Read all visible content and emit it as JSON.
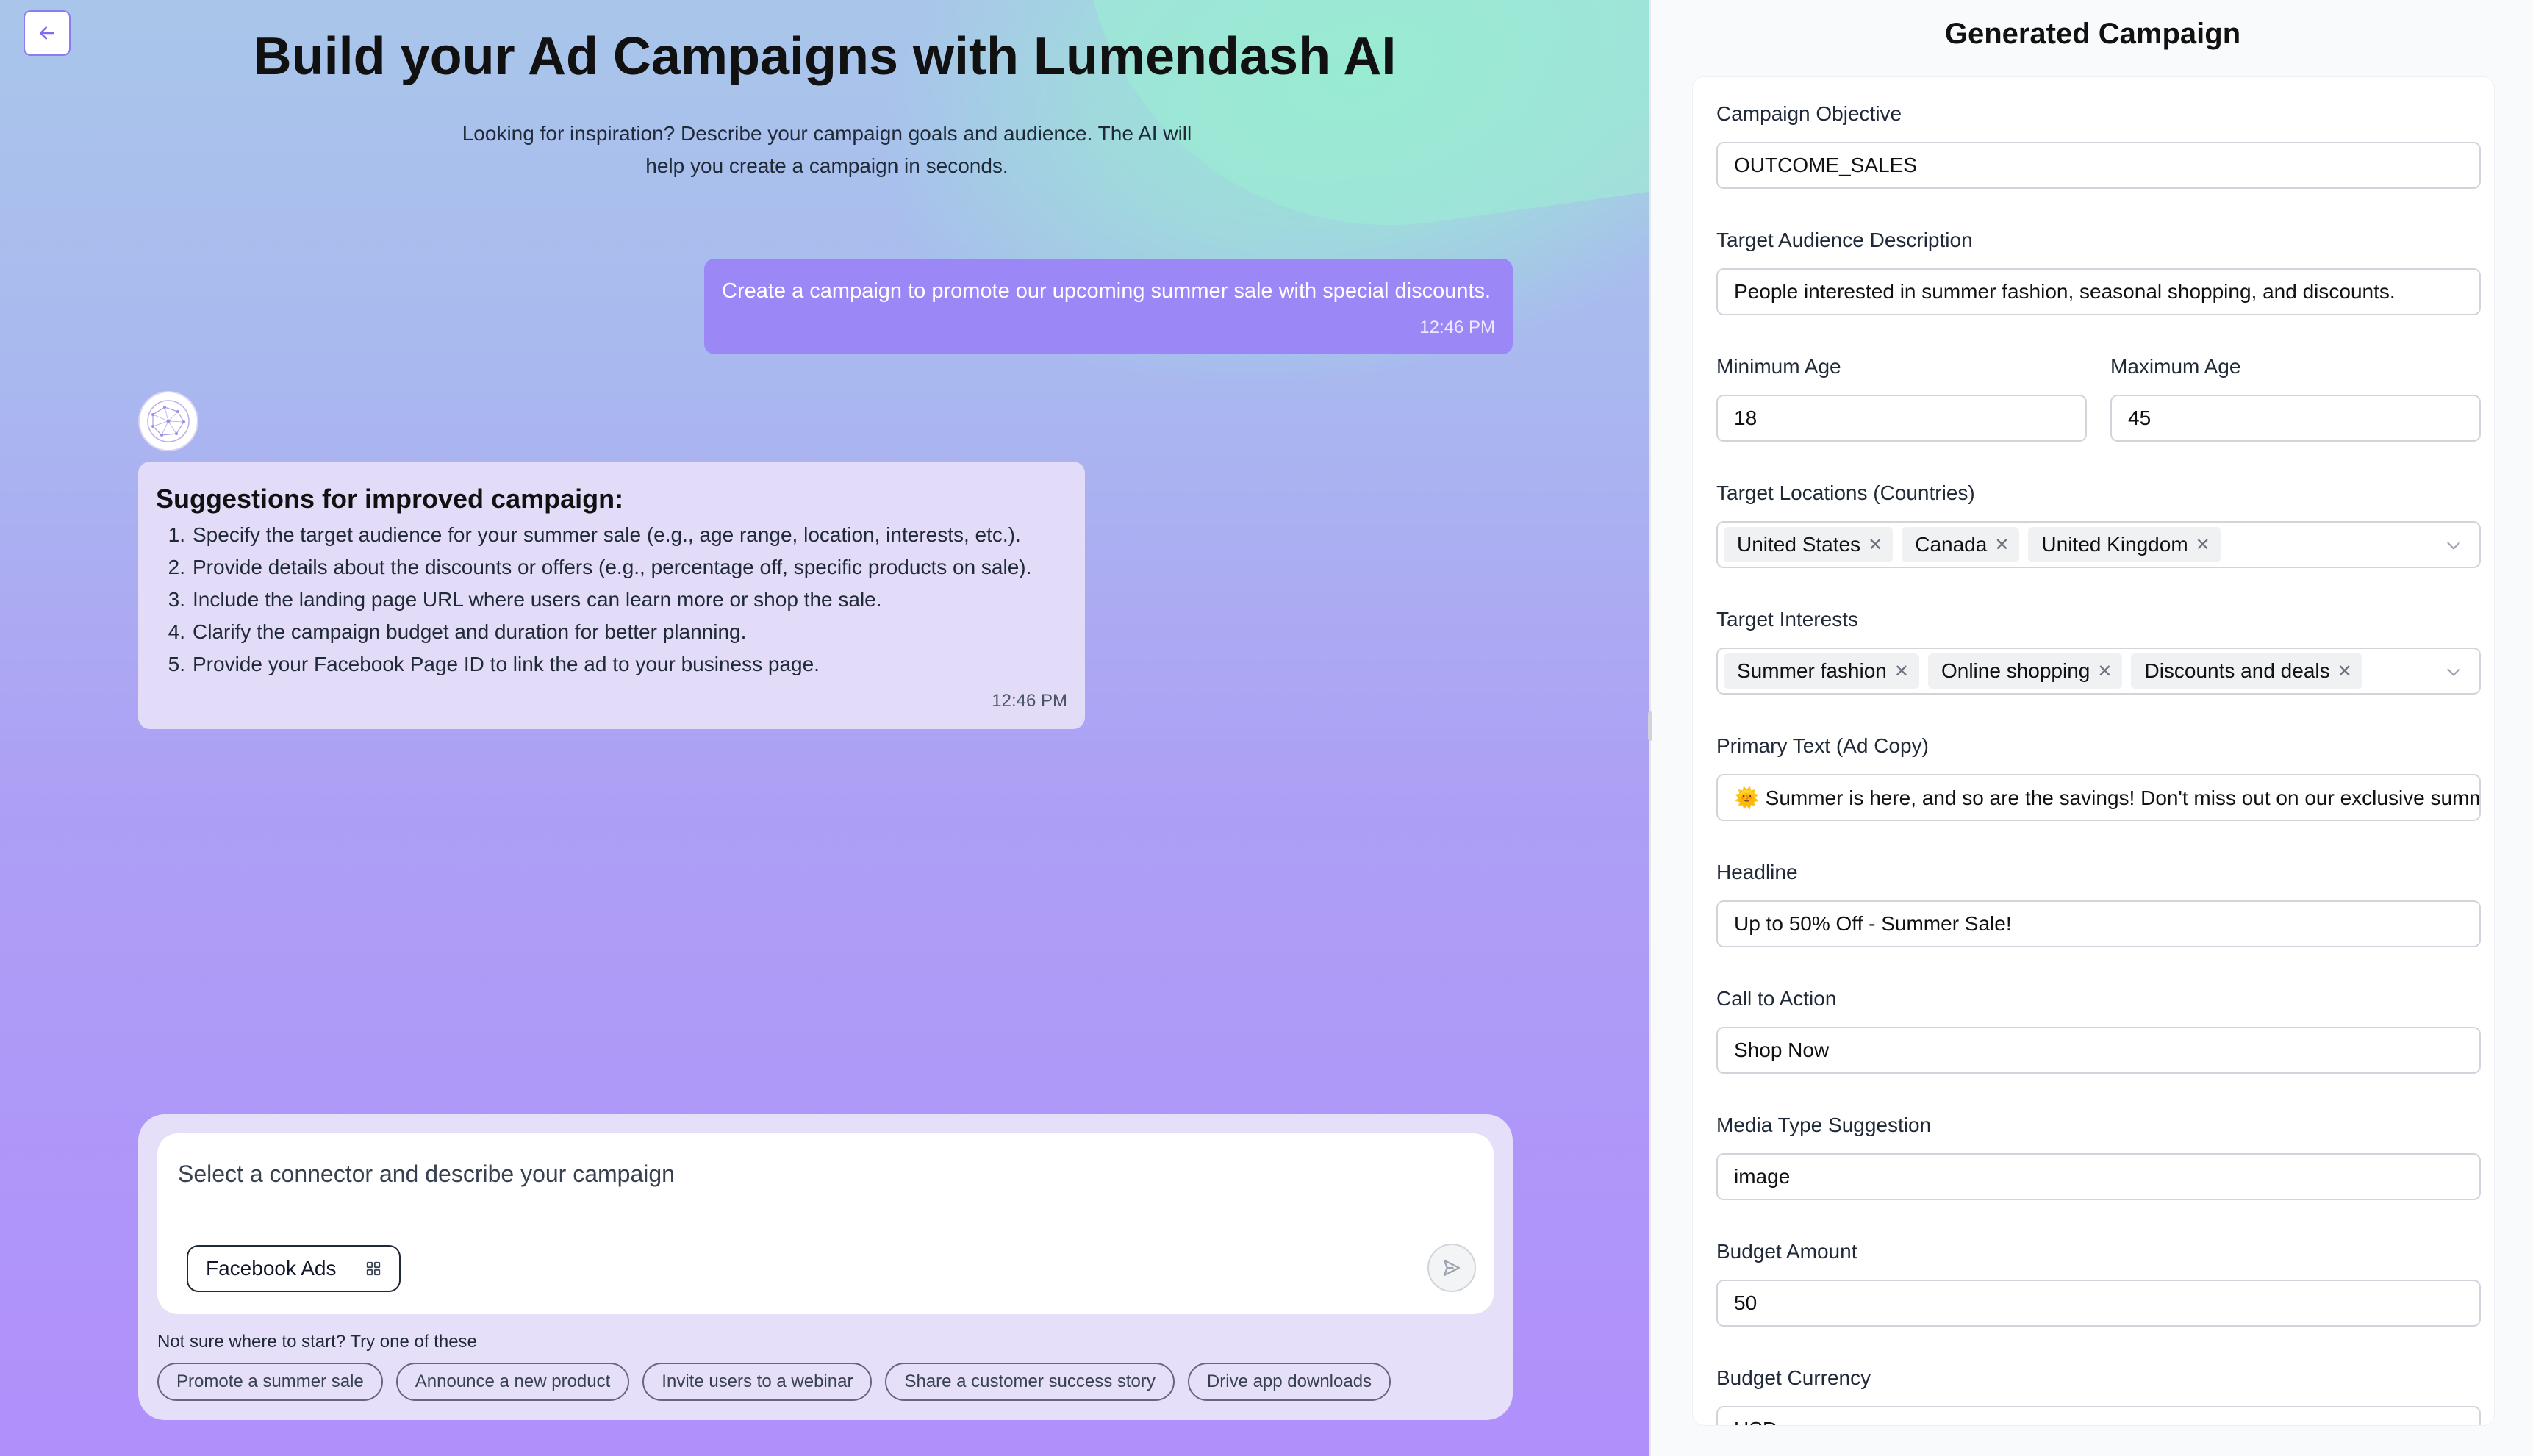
{
  "header": {
    "title": "Build your Ad Campaigns with Lumendash AI",
    "subtitle": "Looking for inspiration? Describe your campaign goals and audience. The AI will help you create a campaign in seconds."
  },
  "chat": {
    "user_message": {
      "text": "Create a campaign to promote our upcoming summer sale with special discounts.",
      "time": "12:46 PM"
    },
    "ai_message": {
      "heading": "Suggestions for improved campaign:",
      "items": [
        {
          "num": "1.",
          "text": "Specify the target audience for your summer sale (e.g., age range, location, interests, etc.)."
        },
        {
          "num": "2.",
          "text": "Provide details about the discounts or offers (e.g., percentage off, specific products on sale)."
        },
        {
          "num": "3.",
          "text": "Include the landing page URL where users can learn more or shop the sale."
        },
        {
          "num": "4.",
          "text": "Clarify the campaign budget and duration for better planning."
        },
        {
          "num": "5.",
          "text": "Provide your Facebook Page ID to link the ad to your business page."
        }
      ],
      "time": "12:46 PM"
    }
  },
  "composer": {
    "placeholder": "Select a connector and describe your campaign",
    "connector_label": "Facebook Ads",
    "hint": "Not sure where to start? Try one of these",
    "suggestions": [
      "Promote a summer sale",
      "Announce a new product",
      "Invite users to a webinar",
      "Share a customer success story",
      "Drive app downloads"
    ]
  },
  "campaign": {
    "title": "Generated Campaign",
    "objective": {
      "label": "Campaign Objective",
      "value": "OUTCOME_SALES"
    },
    "audience": {
      "label": "Target Audience Description",
      "value": "People interested in summer fashion, seasonal shopping, and discounts."
    },
    "min_age": {
      "label": "Minimum Age",
      "value": "18"
    },
    "max_age": {
      "label": "Maximum Age",
      "value": "45"
    },
    "locations": {
      "label": "Target Locations (Countries)",
      "tags": [
        "United States",
        "Canada",
        "United Kingdom"
      ]
    },
    "interests": {
      "label": "Target Interests",
      "tags": [
        "Summer fashion",
        "Online shopping",
        "Discounts and deals"
      ]
    },
    "primary_text": {
      "label": "Primary Text (Ad Copy)",
      "value": "🌞 Summer is here, and so are the savings! Don't miss out on our exclusive summer sale"
    },
    "headline": {
      "label": "Headline",
      "value": "Up to 50% Off - Summer Sale!"
    },
    "cta": {
      "label": "Call to Action",
      "value": "Shop Now"
    },
    "media_type": {
      "label": "Media Type Suggestion",
      "value": "image"
    },
    "budget_amount": {
      "label": "Budget Amount",
      "value": "50"
    },
    "budget_currency": {
      "label": "Budget Currency",
      "value": "USD"
    }
  },
  "colors": {
    "accent": "#9b87f5",
    "user_bubble": "#9b87f5",
    "ai_bubble": "#e2dcf8",
    "composer_bg": "#e5dff9",
    "left_gradient_top": "#a9c6ea",
    "left_gradient_bottom": "#b08ffb",
    "mint_glow": "#98ecd2"
  }
}
